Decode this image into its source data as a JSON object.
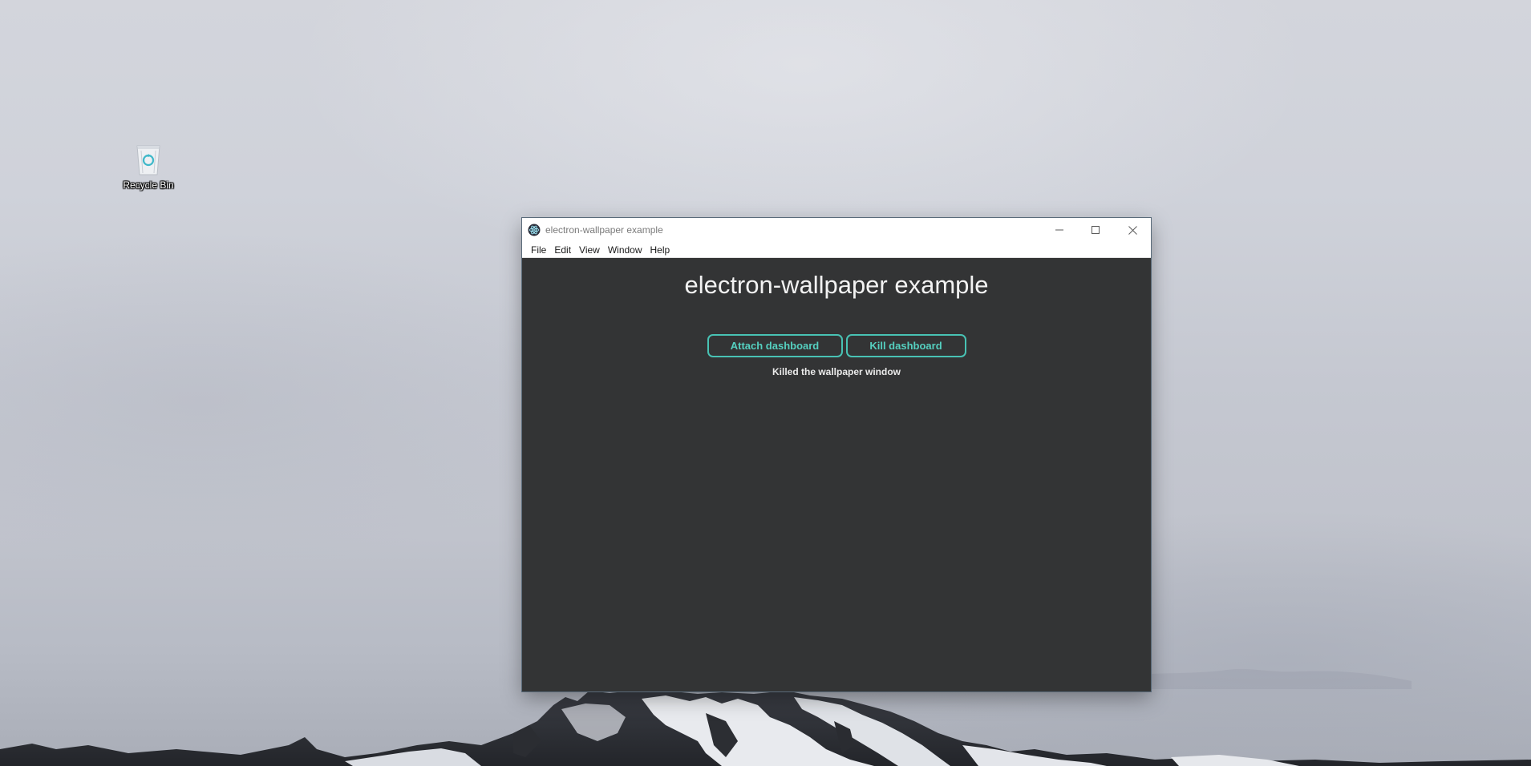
{
  "desktop": {
    "icons": [
      {
        "label": "Recycle Bin",
        "icon": "recycle-bin-icon"
      }
    ]
  },
  "window": {
    "title": "electron-wallpaper example",
    "app_icon": "electron-app-icon",
    "controls": {
      "minimize": "minimize-icon",
      "maximize": "maximize-icon",
      "close": "close-icon"
    },
    "menu": [
      {
        "label": "File"
      },
      {
        "label": "Edit"
      },
      {
        "label": "View"
      },
      {
        "label": "Window"
      },
      {
        "label": "Help"
      }
    ]
  },
  "main": {
    "heading": "electron-wallpaper example",
    "buttons": {
      "attach": "Attach dashboard",
      "kill": "Kill dashboard"
    },
    "status": "Killed the wallpaper window"
  },
  "colors": {
    "content_background": "#333435",
    "accent": "#48c2b4",
    "title_bar": "#ffffff"
  }
}
